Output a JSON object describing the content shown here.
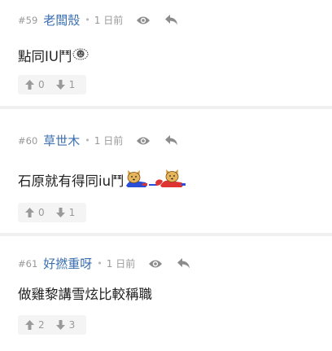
{
  "comments": [
    {
      "floor": "#59",
      "user": "老闆殼",
      "dot": "•",
      "time": "1 日前",
      "text": "點同IU鬥",
      "emojis": [
        "sad-face-emoji"
      ],
      "upvotes": "0",
      "downvotes": "1"
    },
    {
      "floor": "#60",
      "user": "草世木",
      "dot": "•",
      "time": "1 日前",
      "text": "石原就有得同iu鬥",
      "emojis": [
        "dog-bowing-emoji",
        "dog-bowing-emoji"
      ],
      "upvotes": "0",
      "downvotes": "1"
    },
    {
      "floor": "#61",
      "user": "好撚重呀",
      "dot": "•",
      "time": "1 日前",
      "text": "做雞黎講雪炫比較稱職",
      "emojis": [],
      "upvotes": "2",
      "downvotes": "3"
    }
  ],
  "colors": {
    "username": "#3a6fb0",
    "meta": "#999999",
    "vote_bg": "#f4f4f4",
    "separator": "#f0f0f0"
  },
  "icons": {
    "view": "eye-icon",
    "reply": "reply-icon",
    "upvote": "arrow-up-icon",
    "downvote": "arrow-down-icon"
  }
}
